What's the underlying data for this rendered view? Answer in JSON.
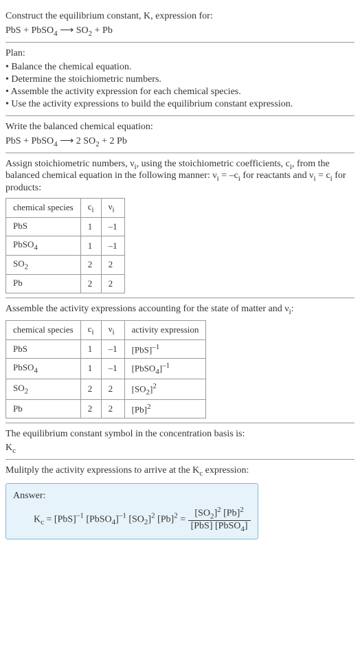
{
  "intro": {
    "line1": "Construct the equilibrium constant, K, expression for:",
    "equation_lhs": "PbS + PbSO",
    "equation_sub1": "4",
    "equation_arrow": " ⟶ ",
    "equation_mid": "SO",
    "equation_sub2": "2",
    "equation_rhs": " + Pb"
  },
  "plan": {
    "title": "Plan:",
    "items": [
      "• Balance the chemical equation.",
      "• Determine the stoichiometric numbers.",
      "• Assemble the activity expression for each chemical species.",
      "• Use the activity expressions to build the equilibrium constant expression."
    ]
  },
  "balanced": {
    "title": "Write the balanced chemical equation:",
    "eq_a": "PbS + PbSO",
    "eq_sub1": "4",
    "eq_arrow": " ⟶ ",
    "eq_b": "2 SO",
    "eq_sub2": "2",
    "eq_c": " + 2 Pb"
  },
  "assign": {
    "text_a": "Assign stoichiometric numbers, ν",
    "sub_i1": "i",
    "text_b": ", using the stoichiometric coefficients, c",
    "sub_i2": "i",
    "text_c": ", from the balanced chemical equation in the following manner: ν",
    "sub_i3": "i",
    "text_d": " = –c",
    "sub_i4": "i",
    "text_e": " for reactants and ν",
    "sub_i5": "i",
    "text_f": " = c",
    "sub_i6": "i",
    "text_g": " for products:"
  },
  "table1": {
    "h1": "chemical species",
    "h2": "c",
    "h2_sub": "i",
    "h3": "ν",
    "h3_sub": "i",
    "rows": [
      {
        "sp": "PbS",
        "sub": "",
        "c": "1",
        "v": "–1"
      },
      {
        "sp": "PbSO",
        "sub": "4",
        "c": "1",
        "v": "–1"
      },
      {
        "sp": "SO",
        "sub": "2",
        "c": "2",
        "v": "2"
      },
      {
        "sp": "Pb",
        "sub": "",
        "c": "2",
        "v": "2"
      }
    ]
  },
  "assemble": {
    "text_a": "Assemble the activity expressions accounting for the state of matter and ν",
    "sub_i": "i",
    "text_b": ":"
  },
  "table2": {
    "h1": "chemical species",
    "h2": "c",
    "h2_sub": "i",
    "h3": "ν",
    "h3_sub": "i",
    "h4": "activity expression",
    "rows": [
      {
        "sp": "PbS",
        "sub": "",
        "c": "1",
        "v": "–1",
        "expr_a": "[PbS]",
        "expr_sub": "",
        "expr_sup": "–1"
      },
      {
        "sp": "PbSO",
        "sub": "4",
        "c": "1",
        "v": "–1",
        "expr_a": "[PbSO",
        "expr_sub": "4",
        "expr_b": "]",
        "expr_sup": "–1"
      },
      {
        "sp": "SO",
        "sub": "2",
        "c": "2",
        "v": "2",
        "expr_a": "[SO",
        "expr_sub": "2",
        "expr_b": "]",
        "expr_sup": "2"
      },
      {
        "sp": "Pb",
        "sub": "",
        "c": "2",
        "v": "2",
        "expr_a": "[Pb]",
        "expr_sub": "",
        "expr_sup": "2"
      }
    ]
  },
  "symbol": {
    "line": "The equilibrium constant symbol in the concentration basis is:",
    "kc_a": "K",
    "kc_sub": "c"
  },
  "multiply": {
    "text_a": "Mulitply the activity expressions to arrive at the K",
    "sub_c": "c",
    "text_b": " expression:"
  },
  "answer": {
    "label": "Answer:",
    "lhs_a": "K",
    "lhs_sub": "c",
    "lhs_eq": " = [PbS]",
    "e1_sup": "–1",
    "e2_a": " [PbSO",
    "e2_sub": "4",
    "e2_b": "]",
    "e2_sup": "–1",
    "e3_a": " [SO",
    "e3_sub": "2",
    "e3_b": "]",
    "e3_sup": "2",
    "e4_a": " [Pb]",
    "e4_sup": "2",
    "eq": " = ",
    "num_a": "[SO",
    "num_sub1": "2",
    "num_b": "]",
    "num_sup1": "2",
    "num_c": " [Pb]",
    "num_sup2": "2",
    "den_a": "[PbS] [PbSO",
    "den_sub": "4",
    "den_b": "]"
  }
}
